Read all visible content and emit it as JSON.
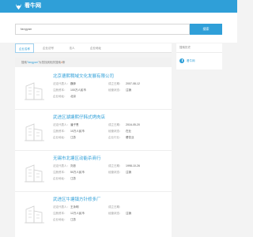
{
  "header": {
    "logo_text": "看牛网",
    "logo_icon": "ox-head-icon",
    "colors": {
      "brand": "#2f9fd8",
      "accent": "#e06b33"
    }
  },
  "search": {
    "value": "fangyan",
    "button_label": "搜索"
  },
  "tabs": [
    {
      "label": "企业名称",
      "active": true
    },
    {
      "label": "企业法号",
      "active": false
    },
    {
      "label": "法人",
      "active": false
    },
    {
      "label": "企业地址",
      "active": false
    }
  ],
  "summary": {
    "prefix": "搜索",
    "keyword": "\"fangyan\"",
    "middle": "为您找到相关搜索",
    "count": "4",
    "suffix": "条"
  },
  "results": [
    {
      "name": "北京德熙稠域文化发展有限公司",
      "rows": [
        [
          {
            "label": "法定代表人：",
            "value": "魏奔"
          },
          {
            "label": "成立日期：",
            "value": "2007-08-12"
          }
        ],
        [
          {
            "label": "注册资本：",
            "value": "100万人民币"
          },
          {
            "label": "经营状态：",
            "value": "注销"
          }
        ],
        [
          {
            "label": "企业地址：",
            "value": "北京"
          }
        ]
      ]
    },
    {
      "name": "武进区湖塘熙仔韩式烤肉店",
      "rows": [
        [
          {
            "label": "法定代表人：",
            "value": "潘子恩"
          },
          {
            "label": "成立日期：",
            "value": "2016-05-20"
          }
        ],
        [
          {
            "label": "注册资本：",
            "value": "10万人民币"
          },
          {
            "label": "经营状态：",
            "value": "在业"
          }
        ],
        [
          {
            "label": "企业地址：",
            "value": "江苏"
          },
          {
            "label": "企业行业：",
            "value": "餐饮业"
          }
        ]
      ]
    },
    {
      "name": "无锡市北塘区动能杀商行",
      "rows": [
        [
          {
            "label": "法定代表人：",
            "value": "刘忠"
          },
          {
            "label": "成立日期：",
            "value": "1998-10-26"
          }
        ],
        [
          {
            "label": "注册资本：",
            "value": "50万人民币"
          },
          {
            "label": "经营状态：",
            "value": "注销"
          }
        ],
        [
          {
            "label": "企业地址：",
            "value": "江苏"
          }
        ]
      ]
    },
    {
      "name": "武进区牛塘镇方针修多厂",
      "rows": [
        [
          {
            "label": "法定代表人：",
            "value": "王永明"
          },
          {
            "label": "成立日期：",
            "value": ""
          }
        ],
        [
          {
            "label": "注册资本：",
            "value": "12万人民币"
          },
          {
            "label": "经营状态：",
            "value": "注销"
          }
        ],
        [
          {
            "label": "企业地址：",
            "value": "江苏"
          }
        ]
      ]
    }
  ],
  "history": {
    "title": "搜索历史",
    "items": [
      "看牛网"
    ]
  }
}
